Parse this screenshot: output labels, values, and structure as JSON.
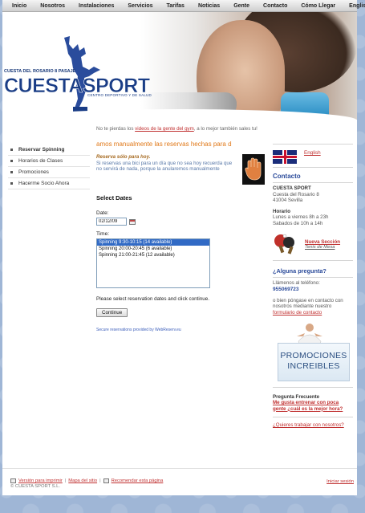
{
  "nav": [
    "Inicio",
    "Nosotros",
    "Instalaciones",
    "Servicios",
    "Tarifas",
    "Noticias",
    "Gente",
    "Contacto",
    "Cómo Llegar",
    "English"
  ],
  "logo": {
    "tagline": "CUESTA DEL ROSARIO 8 PASAJE",
    "brand": "CUESTASPORT",
    "subtitle": "CENTRO DEPORTIVO Y DE SALUD"
  },
  "sidebar": {
    "items": [
      {
        "label": "Reservar Spinning",
        "active": true
      },
      {
        "label": "Horarios de Clases",
        "active": false
      },
      {
        "label": "Promociones",
        "active": false
      },
      {
        "label": "Hacerme Socio Ahora",
        "active": false
      }
    ]
  },
  "main": {
    "intro_pre": "No te pierdas los ",
    "intro_link": "videos de la gente del gym",
    "intro_post": ", a lo mejor también sales tu!",
    "marquee": "amos manualmente las reservas hechas para d",
    "notice_bold": "Reserva sólo para hoy.",
    "notice_text": "Si reservas una bici para un día que no sea hoy recuerda que no servirá de nada, porque la anularemos manualmente",
    "form_title": "Select Dates",
    "date_label": "Date:",
    "date_value": "02/12/09",
    "time_label": "Time:",
    "time_options": [
      {
        "label": "Spinning 9:30-10:15 (14 available)",
        "selected": true
      },
      {
        "label": "Spinning 20:00-20:45 (6 available)",
        "selected": false
      },
      {
        "label": "Spinning 21:00-21:45 (12 available)",
        "selected": false
      }
    ],
    "instruction": "Please select reservation dates and click continue.",
    "continue_label": "Continue",
    "secure_text": "Secure reservations provided by WebReserv.eu"
  },
  "right": {
    "english_link": "English",
    "contact_title": "Contacto",
    "company": "CUESTA SPORT",
    "address1": "Cuesta del Rosario 8",
    "address2": "41004 Sevilla",
    "hours_title": "Horario",
    "hours1": "Lunes a viernes 8h a 23h",
    "hours2": "Sabados de 10h a 14h",
    "new_section": "Nueva Sección",
    "new_section_sub": "Tenis de Mesa",
    "question": "¿Alguna pregunta?",
    "call_text": "Llámenos al teléfono:",
    "phone": "955069723",
    "contact_text": "o bien póngase en contacto con nosotros mediante nuestro ",
    "contact_link": "formulario de contacto",
    "promo_line1": "PROMOCIONES",
    "promo_line2": "INCREIBLES",
    "faq_title": "Pregunta Frecuente",
    "faq_question": "Me gusta entrenar con poca gente ¿cuál es la mejor hora?",
    "jobs_link": "¿Quieres trabajar con nosotros?"
  },
  "footer": {
    "print": "Versión para imprimir",
    "sitemap": "Mapa del sitio",
    "recommend": "Recomendar esta página",
    "copyright": "© CUESTA SPORT S.L.",
    "login": "Iniciar sesión"
  },
  "colors": {
    "brand_blue": "#1a3d86",
    "link_red": "#c03030",
    "marquee_orange": "#e07818",
    "select_blue": "#316ac5"
  }
}
